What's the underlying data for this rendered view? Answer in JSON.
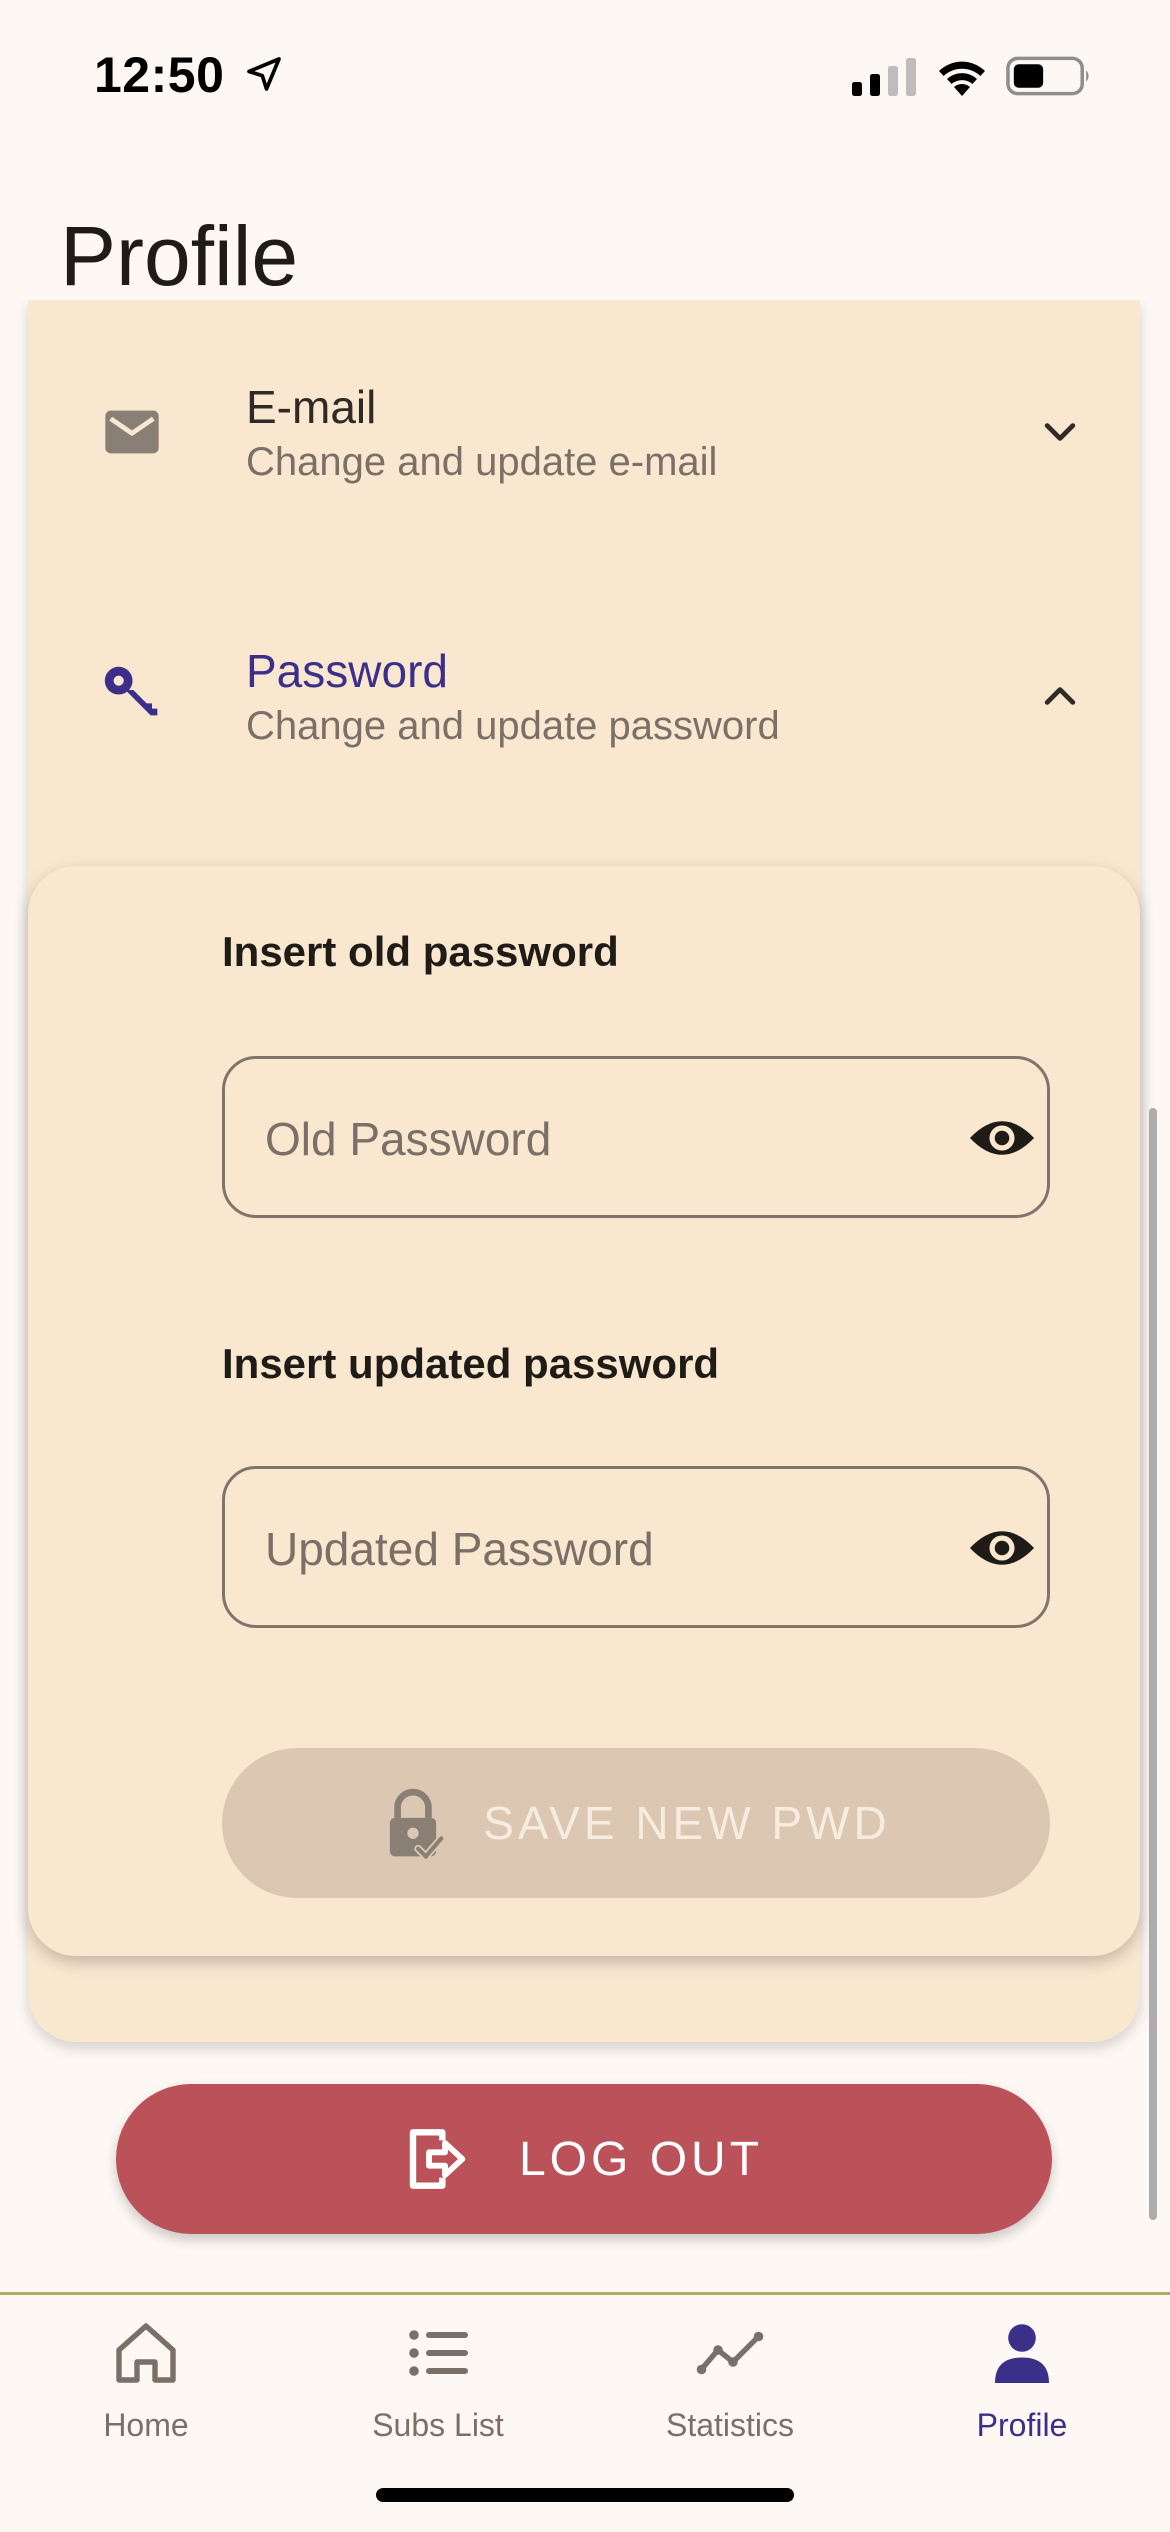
{
  "status_bar": {
    "time": "12:50"
  },
  "page": {
    "title": "Profile"
  },
  "sections": {
    "email": {
      "title": "E-mail",
      "subtitle": "Change and update e-mail",
      "icon": "mail-icon",
      "expanded": false
    },
    "password": {
      "title": "Password",
      "subtitle": "Change and update password",
      "icon": "key-icon",
      "expanded": true
    }
  },
  "password_form": {
    "old_label": "Insert old password",
    "old_placeholder": "Old Password",
    "new_label": "Insert updated password",
    "new_placeholder": "Updated Password",
    "save_label": "SAVE NEW PWD"
  },
  "logout": {
    "label": "LOG OUT"
  },
  "tabs": [
    {
      "label": "Home",
      "icon": "home-icon",
      "active": false
    },
    {
      "label": "Subs List",
      "icon": "list-icon",
      "active": false
    },
    {
      "label": "Statistics",
      "icon": "chart-line-icon",
      "active": false
    },
    {
      "label": "Profile",
      "icon": "person-icon",
      "active": true
    }
  ],
  "colors": {
    "accent": "#3b2f8a",
    "card": "#f9e7d0",
    "logout": "#bb5259",
    "save_disabled": "#dcc8b2",
    "background": "#fdf8f4"
  }
}
